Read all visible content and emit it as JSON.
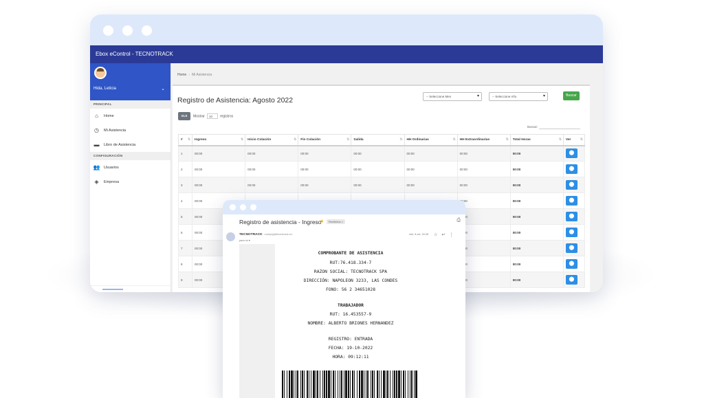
{
  "app": {
    "title": "Ebox eControl - TECNOTRACK",
    "user_name": "Hida, Leticia"
  },
  "sidebar": {
    "sections": [
      {
        "label": "PRINCIPAL",
        "items": [
          {
            "label": "Home",
            "icon": "home-icon"
          },
          {
            "label": "Mi Asistencia",
            "icon": "clock-icon"
          },
          {
            "label": "Libro de Asistencia",
            "icon": "folder-icon"
          }
        ]
      },
      {
        "label": "CONFIGURACIÓN",
        "items": [
          {
            "label": "Usuarios",
            "icon": "users-icon"
          },
          {
            "label": "Empresa",
            "icon": "layers-icon"
          }
        ]
      }
    ]
  },
  "breadcrumb": {
    "home": "Home",
    "current": "Mi Asistencia"
  },
  "page": {
    "title": "Registro de Asistencia: Agosto 2022",
    "month_select": "-- Seleccione Mes",
    "year_select": "-- Seleccione Año",
    "search_button": "Buscar",
    "xls_button": "XLS",
    "show_label": "Mostrar",
    "show_value": "10",
    "records_label": "registros",
    "search_label": "Buscar:"
  },
  "table": {
    "headers": [
      "#",
      "Ingreso",
      "Inicio Colación",
      "Fin Colación",
      "Salida",
      "HH Ordinarias",
      "HH Extraordinarias",
      "Total Horas",
      "Ver"
    ],
    "rows": [
      {
        "n": "1",
        "cells": [
          "00:00",
          "00:00",
          "00:00",
          "00:00",
          "00:00",
          "00:00",
          "00:00"
        ]
      },
      {
        "n": "2",
        "cells": [
          "00:00",
          "00:00",
          "00:00",
          "00:00",
          "00:00",
          "00:00",
          "00:00"
        ]
      },
      {
        "n": "3",
        "cells": [
          "00:00",
          "00:00",
          "00:00",
          "00:00",
          "00:00",
          "00:00",
          "00:00"
        ]
      },
      {
        "n": "4",
        "cells": [
          "00:00",
          "00:00",
          "00:00",
          "00:00",
          "00:00",
          "00:00",
          "00:00"
        ]
      },
      {
        "n": "5",
        "cells": [
          "00:00",
          "",
          "",
          "",
          "",
          "00:00",
          "00:00"
        ]
      },
      {
        "n": "6",
        "cells": [
          "00:00",
          "",
          "",
          "",
          "",
          "00:00",
          "00:00"
        ]
      },
      {
        "n": "7",
        "cells": [
          "00:00",
          "",
          "",
          "",
          "",
          "00:00",
          "00:00"
        ]
      },
      {
        "n": "8",
        "cells": [
          "00:00",
          "",
          "",
          "",
          "",
          "00:00",
          "00:00"
        ]
      },
      {
        "n": "9",
        "cells": [
          "00:00",
          "",
          "",
          "",
          "",
          "00:00",
          "00:00"
        ]
      }
    ],
    "view_icon": "map-pin-icon"
  },
  "email": {
    "subject": "Registro de asistencia - Ingreso",
    "tag": "Recibidos ×",
    "sender": "TECNOTRACK",
    "sender_addr": "<noreply@tecnotrack.cl>",
    "to": "para mí ▾",
    "date": "mié, 8 oct, 20:28",
    "ticket": {
      "title": "COMPROBANTE DE ASISTENCIA",
      "rut": "RUT:76.418.334-7",
      "razon": "RAZON SOCIAL: TECNOTRACK SPA",
      "direccion": "DIRECCIÓN: NAPOLEON 3233, LAS CONDES",
      "fono": "FONO: 56 2 34651028",
      "worker_title": "TRABAJADOR",
      "worker_rut": "RUT: 16.453557-9",
      "worker_name": "NOMBRE: ALBERTO BRIONES HERNANDEZ",
      "registro": "REGISTRO: ENTRADA",
      "fecha": "FECHA: 19-10-2022",
      "hora": "HORA: 09:12:11"
    }
  },
  "colors": {
    "appbar": "#2b3a96",
    "user_panel": "#2f55c6",
    "window_bar": "#dde9fb",
    "search_button": "#46a64a",
    "view_button": "#2d8fe6"
  }
}
